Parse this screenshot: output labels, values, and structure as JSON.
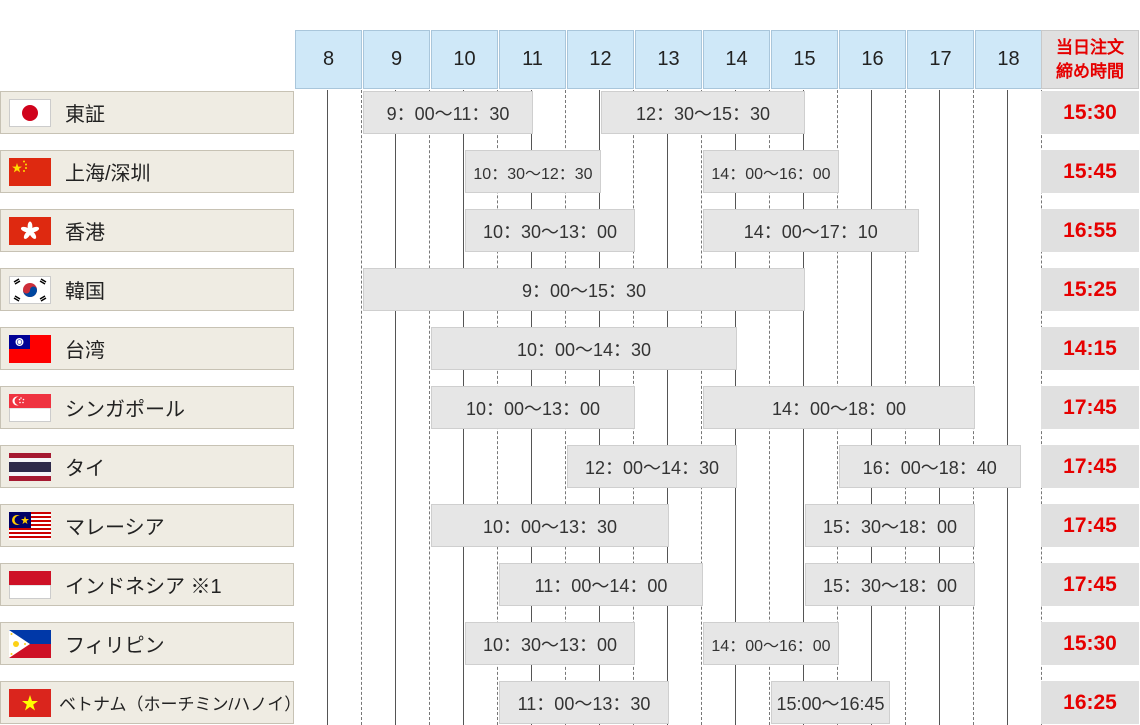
{
  "header": {
    "hours": [
      "8",
      "9",
      "10",
      "11",
      "12",
      "13",
      "14",
      "15",
      "16",
      "17",
      "18"
    ],
    "deadline_line1": "当日注文",
    "deadline_line2": "締め時間"
  },
  "markets": [
    {
      "name": "東証",
      "flag": "japan",
      "cutoff": "15:30",
      "sessions": [
        {
          "label": "9：00〜11：30",
          "start": 9.0,
          "end": 11.5
        },
        {
          "label": "12：30〜15：30",
          "start": 12.5,
          "end": 15.5
        }
      ]
    },
    {
      "name": "上海/深圳",
      "flag": "china",
      "cutoff": "15:45",
      "sessions": [
        {
          "label": "10：30〜12：30",
          "start": 10.5,
          "end": 12.5,
          "small": true
        },
        {
          "label": "14：00〜16：00",
          "start": 14.0,
          "end": 16.0,
          "small": true
        }
      ]
    },
    {
      "name": "香港",
      "flag": "hongkong",
      "cutoff": "16:55",
      "sessions": [
        {
          "label": "10：30〜13：00",
          "start": 10.5,
          "end": 13.0
        },
        {
          "label": "14：00〜17：10",
          "start": 14.0,
          "end": 17.17
        }
      ]
    },
    {
      "name": "韓国",
      "flag": "korea",
      "cutoff": "15:25",
      "sessions": [
        {
          "label": "9：00〜15：30",
          "start": 9.0,
          "end": 15.5
        }
      ]
    },
    {
      "name": "台湾",
      "flag": "taiwan",
      "cutoff": "14:15",
      "sessions": [
        {
          "label": "10：00〜14：30",
          "start": 10.0,
          "end": 14.5
        }
      ]
    },
    {
      "name": "シンガポール",
      "flag": "singapore",
      "cutoff": "17:45",
      "sessions": [
        {
          "label": "10：00〜13：00",
          "start": 10.0,
          "end": 13.0
        },
        {
          "label": "14：00〜18：00",
          "start": 14.0,
          "end": 18.0
        }
      ]
    },
    {
      "name": "タイ",
      "flag": "thailand",
      "cutoff": "17:45",
      "sessions": [
        {
          "label": "12：00〜14：30",
          "start": 12.0,
          "end": 14.5
        },
        {
          "label": "16：00〜18：40",
          "start": 16.0,
          "end": 18.67
        }
      ]
    },
    {
      "name": "マレーシア",
      "flag": "malaysia",
      "cutoff": "17:45",
      "sessions": [
        {
          "label": "10：00〜13：30",
          "start": 10.0,
          "end": 13.5
        },
        {
          "label": "15：30〜18：00",
          "start": 15.5,
          "end": 18.0
        }
      ]
    },
    {
      "name": "インドネシア ※1",
      "flag": "indonesia",
      "cutoff": "17:45",
      "sessions": [
        {
          "label": "11：00〜14：00",
          "start": 11.0,
          "end": 14.0
        },
        {
          "label": "15：30〜18：00",
          "start": 15.5,
          "end": 18.0
        }
      ]
    },
    {
      "name": "フィリピン",
      "flag": "philippines",
      "cutoff": "15:30",
      "sessions": [
        {
          "label": "10：30〜13：00",
          "start": 10.5,
          "end": 13.0
        },
        {
          "label": "14：00〜16：00",
          "start": 14.0,
          "end": 16.0,
          "small": true
        }
      ]
    },
    {
      "name": "ベトナム（ホーチミン/ハノイ）",
      "flag": "vietnam",
      "cutoff": "16:25",
      "small": true,
      "sessions": [
        {
          "label": "11：00〜13：30",
          "start": 11.0,
          "end": 13.5
        },
        {
          "label": "15:00〜16:45",
          "start": 15.0,
          "end": 16.75
        }
      ]
    }
  ],
  "colors": {
    "cutoff": "#e60000",
    "header_bg": "#cfe8f8",
    "session_bg": "#e6e6e6",
    "label_bg": "#efece3"
  }
}
